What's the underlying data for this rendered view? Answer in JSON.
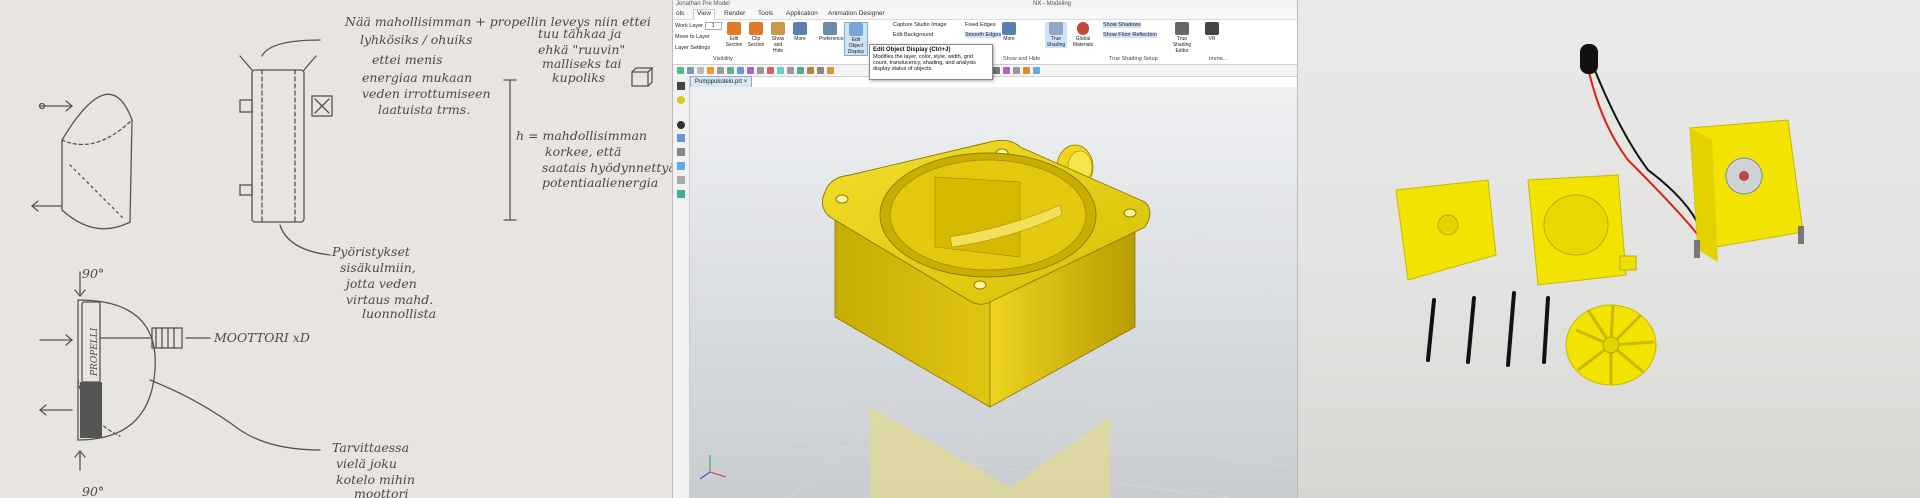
{
  "sketch": {
    "notes": {
      "line1": "Nää mahollisimman + propellin leveys niin ettei",
      "line2": "lyhkösiks / ohuiks",
      "line3a": "ettei menis",
      "line3b": "energiaa mukaan",
      "line3c": "veden irrottumiseen",
      "line3d": "laatuista trms.",
      "right1": "tuu tähkaa ja",
      "right2": "ehkä \"ruuvin\"",
      "right3": "malliseks tai",
      "right4": "kupoliks",
      "h1": "h = mahdollisimman",
      "h2": "korkee, että",
      "h3": "saatais hyödynnettyä",
      "h4": "potentiaalienergia",
      "round1": "Pyöristykset",
      "round2": "sisäkulmiin,",
      "round3": "jotta veden",
      "round4": "virtaus mahd.",
      "round5": "luonnollista",
      "deg_top": "90°",
      "deg_bottom": "90°",
      "propelli": "PROPELLI",
      "motor": "MOOTTORI xD",
      "casing1": "Tarvittaessa",
      "casing2": "vielä joku",
      "casing3": "kotelo mihin",
      "casing4": "moottori"
    }
  },
  "cad": {
    "title_bar": {
      "app_left": "Jonathan Pre Model",
      "app_center": "NX - Modeling"
    },
    "tabs": [
      "ols",
      "View",
      "Render",
      "Tools",
      "Application",
      "Animation Designer"
    ],
    "active_tab": "View",
    "ribbon": {
      "work_layer": "Work Layer",
      "work_layer_value": "1",
      "move_to_layer": "Move to Layer",
      "layer_settings": "Layer Settings",
      "buttons": [
        {
          "label": "Edit Section",
          "color": "#e07a2a"
        },
        {
          "label": "Clip Section",
          "color": "#e07a2a"
        },
        {
          "label": "Show and Hide",
          "color": "#c79a4a"
        },
        {
          "label": "More",
          "color": "#5a7fb0"
        },
        {
          "label": "Preferences",
          "color": "#6a8aa8"
        },
        {
          "label": "Edit Object Display",
          "color": "#7aa6d8"
        },
        {
          "label": "More",
          "color": "#5a7fb0"
        },
        {
          "label": "True Shading",
          "color": "#8fa7c0"
        },
        {
          "label": "Global Materials",
          "color": "#c04a3a"
        },
        {
          "label": "True Shading Editor",
          "color": "#666666"
        },
        {
          "label": "VR",
          "color": "#444444"
        }
      ],
      "capture_studio_image": "Capture Studio Image",
      "fixed_edges": "Fixed Edges",
      "edit_background": "Edit Background",
      "smooth_edges": "Smooth Edges",
      "show_shadows": "Show Shadows",
      "show_floor_reflection": "Show Floor Reflection",
      "visibility_group": "Visibility",
      "true_shading_setup_group": "True Shading Setup",
      "immersive_group": "Imme...",
      "show_and_hide": "Show and Hide"
    },
    "tooltip": {
      "title": "Edit Object Display (Ctrl+J)",
      "body": "Modifies the layer, color, style, width, grid count, translucency, shading, and analysis display status of objects."
    },
    "doc_tab": "Pumppukotelo.prt",
    "model_color": "#e8cf12"
  },
  "photo": {
    "part_color": "#f2e400",
    "screw_color": "#111111"
  }
}
